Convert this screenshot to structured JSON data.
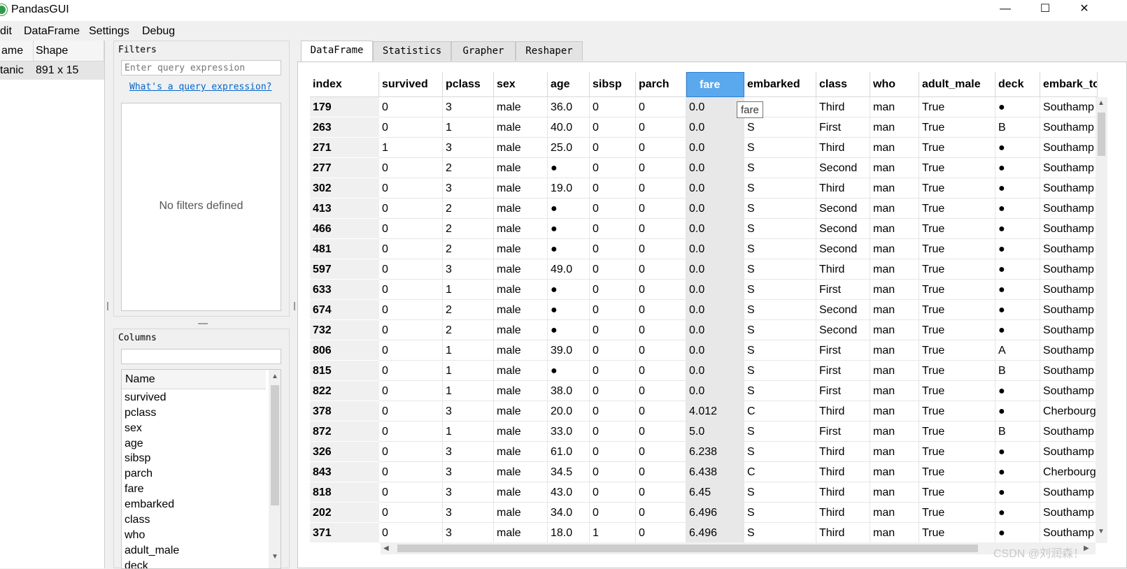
{
  "window": {
    "title": "PandasGUI",
    "minimize": "—",
    "maximize": "☐",
    "close": "✕"
  },
  "menu": [
    "dit",
    "DataFrame",
    "Settings",
    "Debug"
  ],
  "dataframe_list": {
    "headers": [
      "ame",
      "Shape"
    ],
    "rows": [
      {
        "name": "tanic",
        "shape": "891 x 15"
      }
    ]
  },
  "filters": {
    "title": "Filters",
    "placeholder": "Enter query expression",
    "help_link": "What's a query expression?",
    "empty_text": "No filters defined"
  },
  "columns_panel": {
    "title": "Columns",
    "search_value": "",
    "list_header": "Name",
    "items": [
      "survived",
      "pclass",
      "sex",
      "age",
      "sibsp",
      "parch",
      "fare",
      "embarked",
      "class",
      "who",
      "adult_male",
      "deck"
    ]
  },
  "tabs": [
    {
      "label": "DataFrame",
      "active": true
    },
    {
      "label": "Statistics",
      "active": false
    },
    {
      "label": "Grapher",
      "active": false
    },
    {
      "label": "Reshaper",
      "active": false
    }
  ],
  "table": {
    "index_header": "index",
    "columns": [
      "survived",
      "pclass",
      "sex",
      "age",
      "sibsp",
      "parch",
      "fare",
      "embarked",
      "class",
      "who",
      "adult_male",
      "deck",
      "embark_to"
    ],
    "selected_column": "fare",
    "rows": [
      {
        "index": "179",
        "cells": [
          "0",
          "3",
          "male",
          "36.0",
          "0",
          "0",
          "0.0",
          "",
          "Third",
          "man",
          "True",
          "●",
          "Southamp"
        ]
      },
      {
        "index": "263",
        "cells": [
          "0",
          "1",
          "male",
          "40.0",
          "0",
          "0",
          "0.0",
          "S",
          "First",
          "man",
          "True",
          "B",
          "Southamp"
        ]
      },
      {
        "index": "271",
        "cells": [
          "1",
          "3",
          "male",
          "25.0",
          "0",
          "0",
          "0.0",
          "S",
          "Third",
          "man",
          "True",
          "●",
          "Southamp"
        ]
      },
      {
        "index": "277",
        "cells": [
          "0",
          "2",
          "male",
          "●",
          "0",
          "0",
          "0.0",
          "S",
          "Second",
          "man",
          "True",
          "●",
          "Southamp"
        ]
      },
      {
        "index": "302",
        "cells": [
          "0",
          "3",
          "male",
          "19.0",
          "0",
          "0",
          "0.0",
          "S",
          "Third",
          "man",
          "True",
          "●",
          "Southamp"
        ]
      },
      {
        "index": "413",
        "cells": [
          "0",
          "2",
          "male",
          "●",
          "0",
          "0",
          "0.0",
          "S",
          "Second",
          "man",
          "True",
          "●",
          "Southamp"
        ]
      },
      {
        "index": "466",
        "cells": [
          "0",
          "2",
          "male",
          "●",
          "0",
          "0",
          "0.0",
          "S",
          "Second",
          "man",
          "True",
          "●",
          "Southamp"
        ]
      },
      {
        "index": "481",
        "cells": [
          "0",
          "2",
          "male",
          "●",
          "0",
          "0",
          "0.0",
          "S",
          "Second",
          "man",
          "True",
          "●",
          "Southamp"
        ]
      },
      {
        "index": "597",
        "cells": [
          "0",
          "3",
          "male",
          "49.0",
          "0",
          "0",
          "0.0",
          "S",
          "Third",
          "man",
          "True",
          "●",
          "Southamp"
        ]
      },
      {
        "index": "633",
        "cells": [
          "0",
          "1",
          "male",
          "●",
          "0",
          "0",
          "0.0",
          "S",
          "First",
          "man",
          "True",
          "●",
          "Southamp"
        ]
      },
      {
        "index": "674",
        "cells": [
          "0",
          "2",
          "male",
          "●",
          "0",
          "0",
          "0.0",
          "S",
          "Second",
          "man",
          "True",
          "●",
          "Southamp"
        ]
      },
      {
        "index": "732",
        "cells": [
          "0",
          "2",
          "male",
          "●",
          "0",
          "0",
          "0.0",
          "S",
          "Second",
          "man",
          "True",
          "●",
          "Southamp"
        ]
      },
      {
        "index": "806",
        "cells": [
          "0",
          "1",
          "male",
          "39.0",
          "0",
          "0",
          "0.0",
          "S",
          "First",
          "man",
          "True",
          "A",
          "Southamp"
        ]
      },
      {
        "index": "815",
        "cells": [
          "0",
          "1",
          "male",
          "●",
          "0",
          "0",
          "0.0",
          "S",
          "First",
          "man",
          "True",
          "B",
          "Southamp"
        ]
      },
      {
        "index": "822",
        "cells": [
          "0",
          "1",
          "male",
          "38.0",
          "0",
          "0",
          "0.0",
          "S",
          "First",
          "man",
          "True",
          "●",
          "Southamp"
        ]
      },
      {
        "index": "378",
        "cells": [
          "0",
          "3",
          "male",
          "20.0",
          "0",
          "0",
          "4.012",
          "C",
          "Third",
          "man",
          "True",
          "●",
          "Cherbourg"
        ]
      },
      {
        "index": "872",
        "cells": [
          "0",
          "1",
          "male",
          "33.0",
          "0",
          "0",
          "5.0",
          "S",
          "First",
          "man",
          "True",
          "B",
          "Southamp"
        ]
      },
      {
        "index": "326",
        "cells": [
          "0",
          "3",
          "male",
          "61.0",
          "0",
          "0",
          "6.238",
          "S",
          "Third",
          "man",
          "True",
          "●",
          "Southamp"
        ]
      },
      {
        "index": "843",
        "cells": [
          "0",
          "3",
          "male",
          "34.5",
          "0",
          "0",
          "6.438",
          "C",
          "Third",
          "man",
          "True",
          "●",
          "Cherbourg"
        ]
      },
      {
        "index": "818",
        "cells": [
          "0",
          "3",
          "male",
          "43.0",
          "0",
          "0",
          "6.45",
          "S",
          "Third",
          "man",
          "True",
          "●",
          "Southamp"
        ]
      },
      {
        "index": "202",
        "cells": [
          "0",
          "3",
          "male",
          "34.0",
          "0",
          "0",
          "6.496",
          "S",
          "Third",
          "man",
          "True",
          "●",
          "Southamp"
        ]
      },
      {
        "index": "371",
        "cells": [
          "0",
          "3",
          "male",
          "18.0",
          "1",
          "0",
          "6.496",
          "S",
          "Third",
          "man",
          "True",
          "●",
          "Southamp"
        ]
      }
    ]
  },
  "tooltip": "fare",
  "watermark": "CSDN @刘润森！",
  "colors": {
    "selected_header": "#5aa8ee",
    "link": "#0066cc",
    "app_icon": "#2d9b49"
  }
}
